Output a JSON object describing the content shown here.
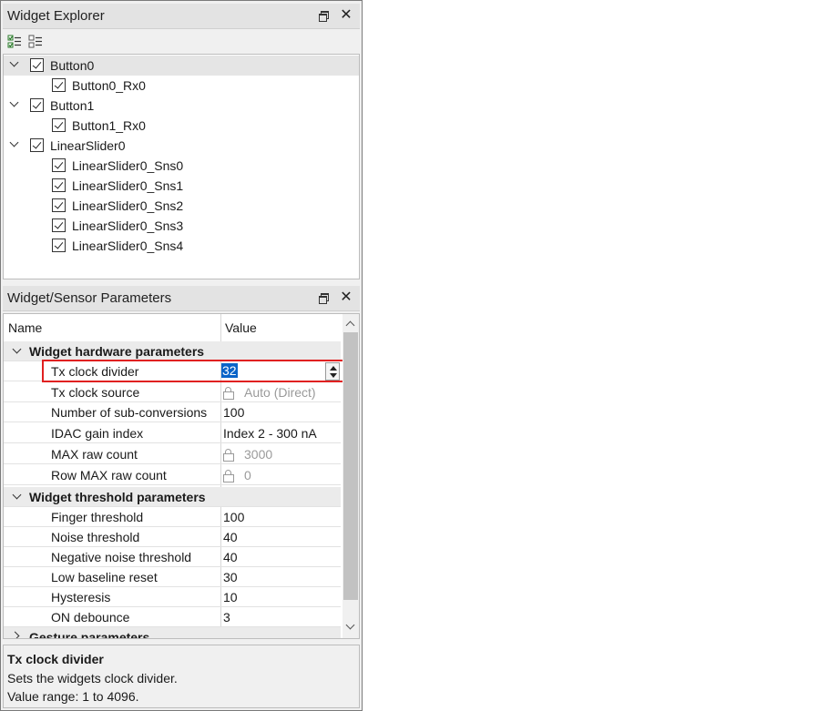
{
  "widget_explorer": {
    "title": "Widget Explorer",
    "toolbar": {
      "check_all_icon": "check-all-icon",
      "uncheck_all_icon": "uncheck-all-icon"
    },
    "items": [
      {
        "label": "Button0",
        "level": 0,
        "checked": true,
        "expanded": true,
        "selected": true
      },
      {
        "label": "Button0_Rx0",
        "level": 1,
        "checked": true
      },
      {
        "label": "Button1",
        "level": 0,
        "checked": true,
        "expanded": true
      },
      {
        "label": "Button1_Rx0",
        "level": 1,
        "checked": true
      },
      {
        "label": "LinearSlider0",
        "level": 0,
        "checked": true,
        "expanded": true
      },
      {
        "label": "LinearSlider0_Sns0",
        "level": 1,
        "checked": true
      },
      {
        "label": "LinearSlider0_Sns1",
        "level": 1,
        "checked": true
      },
      {
        "label": "LinearSlider0_Sns2",
        "level": 1,
        "checked": true
      },
      {
        "label": "LinearSlider0_Sns3",
        "level": 1,
        "checked": true
      },
      {
        "label": "LinearSlider0_Sns4",
        "level": 1,
        "checked": true
      }
    ]
  },
  "parameters": {
    "title": "Widget/Sensor Parameters",
    "columns": {
      "name": "Name",
      "value": "Value"
    },
    "groups": [
      {
        "label": "Widget hardware parameters",
        "expanded": true,
        "rows": [
          {
            "name": "Tx clock divider",
            "value": "32",
            "editing": true
          },
          {
            "name": "Tx clock source",
            "value": "Auto (Direct)",
            "locked": true
          },
          {
            "name": "Number of sub-conversions",
            "value": "100"
          },
          {
            "name": "IDAC gain index",
            "value": "Index 2 - 300 nA"
          },
          {
            "name": "MAX raw count",
            "value": "3000",
            "locked": true
          },
          {
            "name": "Row MAX raw count",
            "value": "0",
            "locked": true
          }
        ]
      },
      {
        "label": "Widget threshold parameters",
        "expanded": true,
        "rows": [
          {
            "name": "Finger threshold",
            "value": "100"
          },
          {
            "name": "Noise threshold",
            "value": "40"
          },
          {
            "name": "Negative noise threshold",
            "value": "40"
          },
          {
            "name": "Low baseline reset",
            "value": "30"
          },
          {
            "name": "Hysteresis",
            "value": "10"
          },
          {
            "name": "ON debounce",
            "value": "3"
          }
        ]
      },
      {
        "label": "Gesture parameters",
        "expanded": false,
        "rows": []
      }
    ]
  },
  "description": {
    "title": "Tx clock divider",
    "line1": "Sets the widgets clock divider.",
    "line2": "Value range: 1 to 4096."
  },
  "colors": {
    "highlight_border": "#e02020",
    "selection_bg": "#0a64c8"
  }
}
